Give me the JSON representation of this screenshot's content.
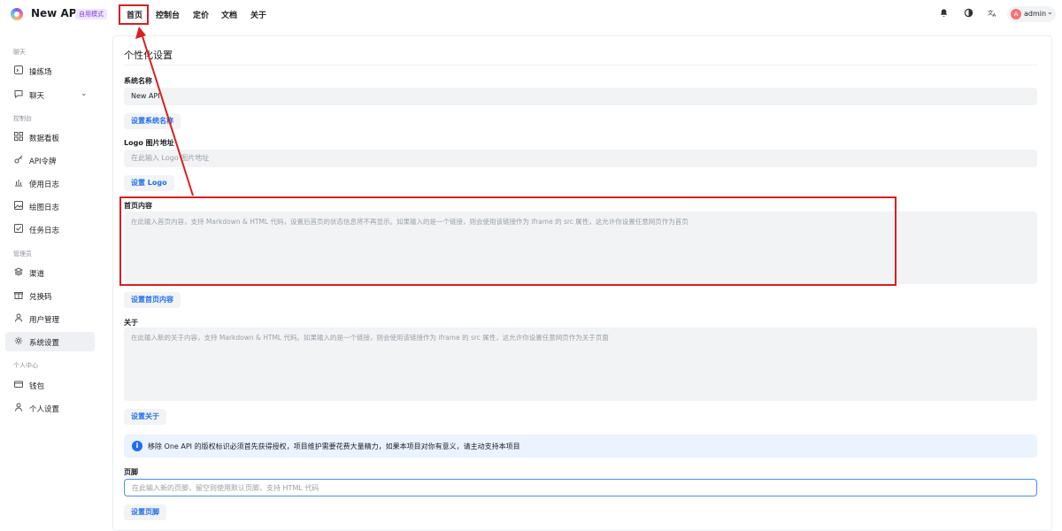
{
  "header": {
    "app_title": "New API",
    "mode_badge": "自用模式",
    "nav": [
      "首页",
      "控制台",
      "定价",
      "文档",
      "关于"
    ],
    "user": {
      "avatar_letter": "A",
      "name": "admin"
    }
  },
  "sidebar": {
    "sections": [
      {
        "title": "聊天",
        "items": [
          {
            "label": "操练场",
            "icon": "playground-icon"
          },
          {
            "label": "聊天",
            "icon": "chat-icon",
            "expandable": true
          }
        ]
      },
      {
        "title": "控制台",
        "items": [
          {
            "label": "数据看板",
            "icon": "dashboard-icon"
          },
          {
            "label": "API令牌",
            "icon": "key-icon"
          },
          {
            "label": "使用日志",
            "icon": "bar-chart-icon"
          },
          {
            "label": "绘图日志",
            "icon": "image-icon"
          },
          {
            "label": "任务日志",
            "icon": "task-icon"
          }
        ]
      },
      {
        "title": "管理员",
        "items": [
          {
            "label": "渠道",
            "icon": "layers-icon"
          },
          {
            "label": "兑换码",
            "icon": "gift-icon"
          },
          {
            "label": "用户管理",
            "icon": "user-icon"
          },
          {
            "label": "系统设置",
            "icon": "gear-icon",
            "active": true
          }
        ]
      },
      {
        "title": "个人中心",
        "items": [
          {
            "label": "钱包",
            "icon": "wallet-icon"
          },
          {
            "label": "个人设置",
            "icon": "person-icon"
          }
        ]
      }
    ]
  },
  "main": {
    "title": "个性化设置",
    "system_name": {
      "label": "系统名称",
      "value": "New API",
      "button": "设置系统名称"
    },
    "logo": {
      "label": "Logo 图片地址",
      "placeholder": "在此输入 Logo 图片地址",
      "button": "设置 Logo"
    },
    "home_content": {
      "label": "首页内容",
      "placeholder": "在此输入首页内容，支持 Markdown & HTML 代码，设置后首页的状态信息将不再显示。如果输入的是一个链接，则会使用该链接作为 iframe 的 src 属性，这允许你设置任意网页作为首页",
      "button": "设置首页内容"
    },
    "about": {
      "label": "关于",
      "placeholder": "在此输入新的关于内容，支持 Markdown & HTML 代码。如果输入的是一个链接，则会使用该链接作为 iframe 的 src 属性，这允许你设置任意网页作为关于页面",
      "button": "设置关于"
    },
    "notice": "移除 One API 的版权标识必须首先获得授权，项目维护需要花费大量精力，如果本项目对你有意义，请主动支持本项目",
    "footer": {
      "label": "页脚",
      "placeholder": "在此输入新的页脚，留空则使用默认页脚，支持 HTML 代码",
      "button": "设置页脚"
    }
  },
  "colors": {
    "accent": "#1f6ff0",
    "annotation_red": "#d9201f"
  }
}
